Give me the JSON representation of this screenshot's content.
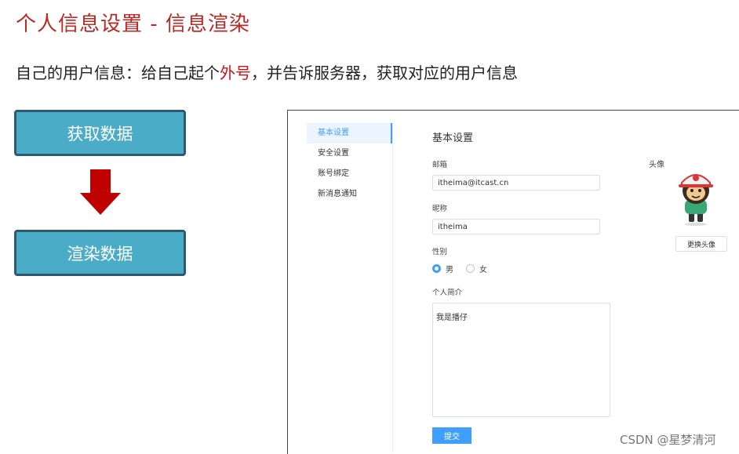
{
  "slide": {
    "title": "个人信息设置 - 信息渲染",
    "subtitle_pre": "自己的用户信息：给自己起个",
    "subtitle_highlight": "外号",
    "subtitle_post": "，并告诉服务器，获取对应的用户信息"
  },
  "flow": {
    "step1": "获取数据",
    "step2": "渲染数据",
    "arrow_color": "#c00000",
    "box_color": "#4aacc6"
  },
  "app": {
    "sidebar": {
      "items": [
        {
          "label": "基本设置",
          "active": true
        },
        {
          "label": "安全设置",
          "active": false
        },
        {
          "label": "账号绑定",
          "active": false
        },
        {
          "label": "新消息通知",
          "active": false
        }
      ]
    },
    "panel_title": "基本设置",
    "email": {
      "label": "邮箱",
      "value": "itheima@itcast.cn"
    },
    "nickname": {
      "label": "昵称",
      "value": "itheima"
    },
    "gender": {
      "label": "性别",
      "options": [
        {
          "label": "男",
          "checked": true
        },
        {
          "label": "女",
          "checked": false
        }
      ]
    },
    "bio": {
      "label": "个人简介",
      "value": "我是播仔"
    },
    "submit_label": "提交",
    "avatar": {
      "label": "头像",
      "change_label": "更换头像"
    },
    "accent": "#409eff"
  },
  "watermark": "CSDN @星梦清河"
}
